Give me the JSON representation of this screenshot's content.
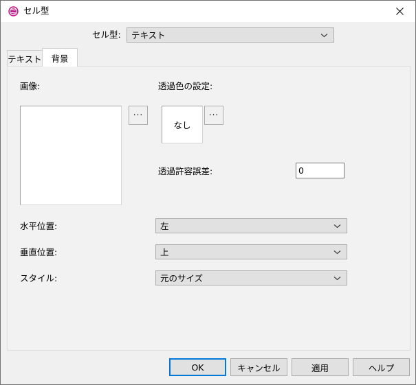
{
  "window": {
    "title": "セル型",
    "icon": "app-icon",
    "icon_color": "#c2188d",
    "close_label": "×"
  },
  "celltype": {
    "label": "セル型:",
    "value": "テキスト"
  },
  "tabs": [
    {
      "label": "テキスト",
      "active": false
    },
    {
      "label": "背景",
      "active": true
    }
  ],
  "background_tab": {
    "image": {
      "label": "画像:",
      "value": "",
      "browse_label": "..."
    },
    "transparent_color": {
      "label": "透過色の設定:",
      "value": "なし",
      "browse_label": "..."
    },
    "tolerance": {
      "label": "透過許容誤差:",
      "value": "0"
    },
    "horizontal_position": {
      "label": "水平位置:",
      "value": "左"
    },
    "vertical_position": {
      "label": "垂直位置:",
      "value": "上"
    },
    "style": {
      "label": "スタイル:",
      "value": "元のサイズ"
    }
  },
  "buttons": {
    "ok": "OK",
    "cancel": "キャンセル",
    "apply": "適用",
    "help": "ヘルプ"
  },
  "colors": {
    "accent": "#0078d7",
    "dialog_bg": "#f0f0f0",
    "panel_bg": "#f2f2f2",
    "control_bg": "#e1e1e1",
    "border": "#adadad"
  }
}
